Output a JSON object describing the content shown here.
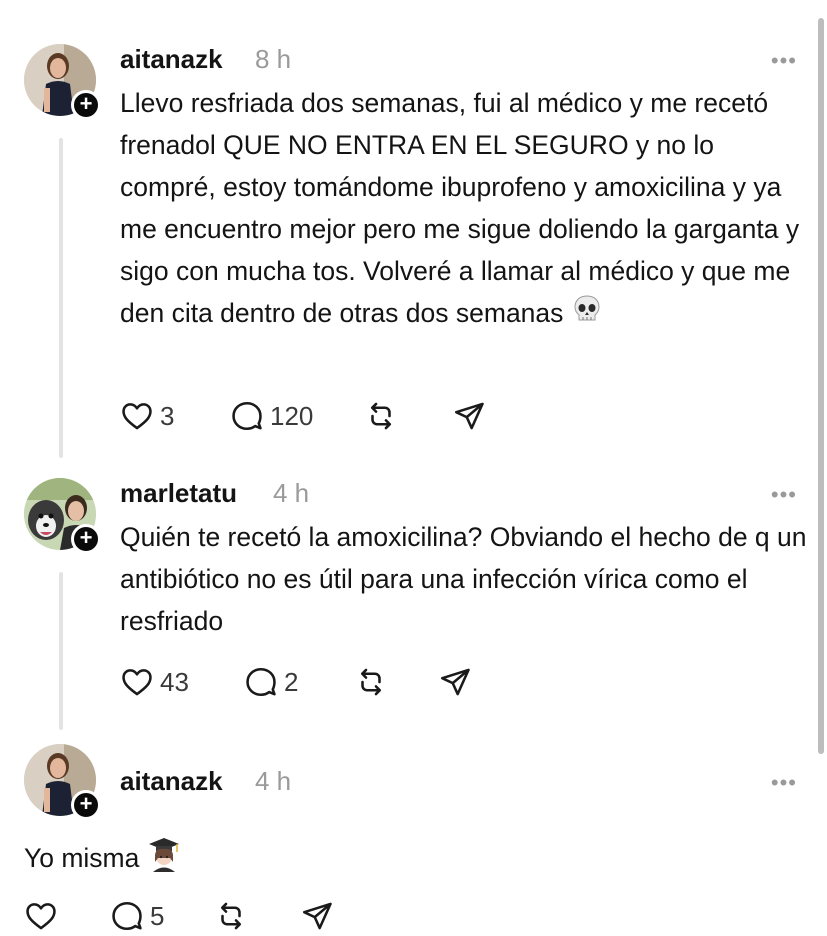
{
  "posts": [
    {
      "username": "aitanazk",
      "time": "8 h",
      "more": "•••",
      "text": "Llevo resfriada dos semanas, fui al médico y me recetó frenadol QUE NO ENTRA EN EL SEGURO y no lo compré, estoy tomándome ibuprofeno y amoxicilina y ya me encuentro mejor pero me sigue doliendo la garganta y sigo con mucha tos. Volveré a llamar al médico y que me den cita dentro de otras dos semanas",
      "emoji": "skull",
      "likes": "3",
      "replies": "120"
    },
    {
      "username": "marletatu",
      "time": "4 h",
      "more": "•••",
      "text": "Quién te recetó la amoxicilina? Obviando el hecho de q un antibiótico no es útil para una infección vírica como el resfriado",
      "likes": "43",
      "replies": "2"
    },
    {
      "username": "aitanazk",
      "time": "4 h",
      "more": "•••",
      "text": "Yo misma",
      "emoji": "woman-student",
      "likes": "",
      "replies": "5"
    }
  ],
  "icons": {
    "like": "heart-icon",
    "reply": "comment-icon",
    "repost": "repost-icon",
    "share": "send-icon",
    "follow": "plus-icon"
  }
}
